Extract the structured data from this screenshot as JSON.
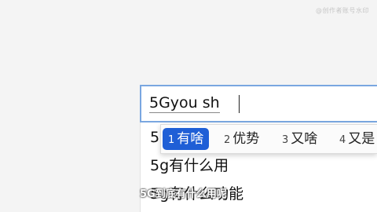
{
  "watermark": "@创作者账号水印",
  "search": {
    "value": "5Gyou sh"
  },
  "ime": {
    "candidates": [
      {
        "num": "1",
        "text": "有啥",
        "selected": true
      },
      {
        "num": "2",
        "text": "优势",
        "selected": false
      },
      {
        "num": "3",
        "text": "又啥",
        "selected": false
      },
      {
        "num": "4",
        "text": "又是",
        "selected": false
      }
    ]
  },
  "suggestions": [
    "5",
    "5g有什么用",
    "5g有什么功能"
  ],
  "subtitle": "5G到底有什么用呢",
  "colors": {
    "accent": "#1f5fd6",
    "search_border": "#7aa7e0"
  }
}
